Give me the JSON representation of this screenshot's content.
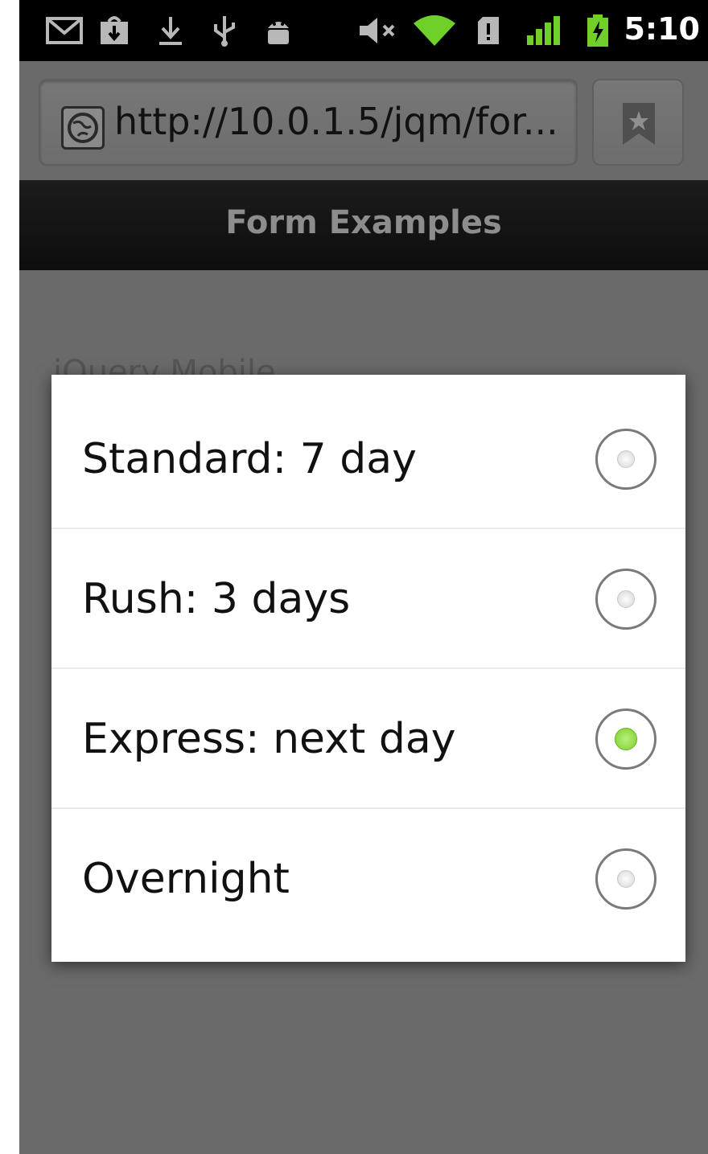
{
  "status_bar": {
    "time": "5:10",
    "icons": [
      "gmail-icon",
      "market-download-icon",
      "download-icon",
      "usb-icon",
      "android-debug-icon",
      "mute-icon",
      "wifi-icon",
      "sd-card-icon",
      "signal-icon",
      "battery-charging-icon"
    ]
  },
  "browser": {
    "url": "http://10.0.1.5/jqm/for...",
    "icons": [
      "globe-icon",
      "bookmark-icon"
    ]
  },
  "header": {
    "title": "Form Examples"
  },
  "background_content": {
    "partial_text": "jQuery Mobile"
  },
  "dialog": {
    "options": [
      {
        "label": "Standard: 7 day",
        "selected": false
      },
      {
        "label": "Rush: 3 days",
        "selected": false
      },
      {
        "label": "Express: next day",
        "selected": true
      },
      {
        "label": "Overnight",
        "selected": false
      }
    ]
  },
  "colors": {
    "radio_selected": "#7fcf2c",
    "header_bg": "#111111",
    "overlay_bg": "#6a6a6a"
  }
}
